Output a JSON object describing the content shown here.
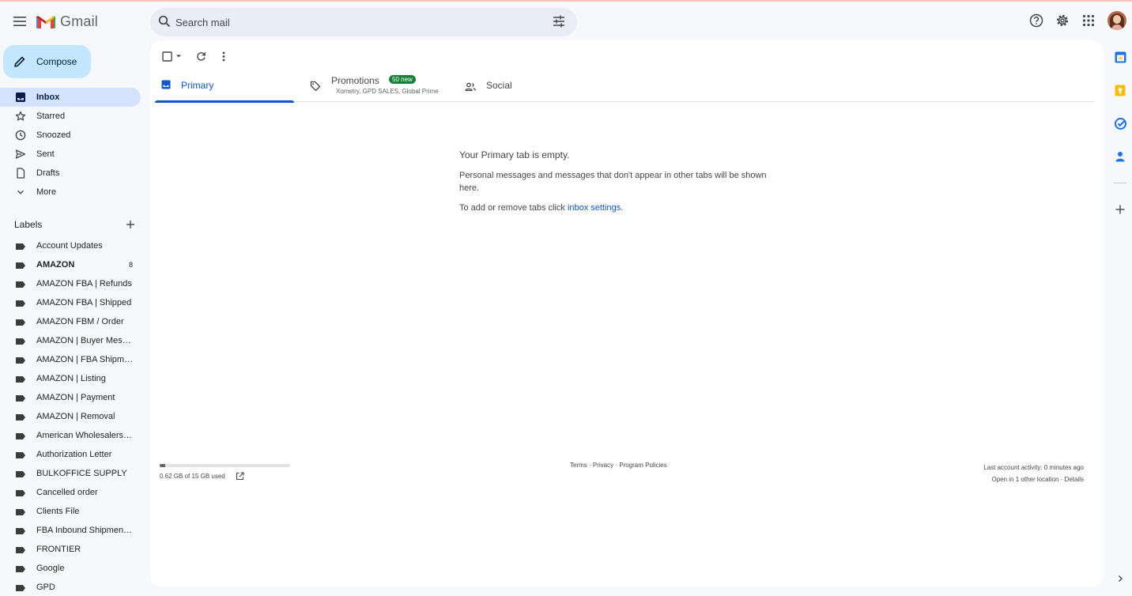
{
  "app": {
    "name": "Gmail"
  },
  "search": {
    "placeholder": "Search mail"
  },
  "compose": {
    "label": "Compose"
  },
  "nav": [
    {
      "label": "Inbox",
      "icon": "inbox-icon",
      "active": true
    },
    {
      "label": "Starred",
      "icon": "star-icon"
    },
    {
      "label": "Snoozed",
      "icon": "clock-icon"
    },
    {
      "label": "Sent",
      "icon": "send-icon"
    },
    {
      "label": "Drafts",
      "icon": "draft-icon"
    },
    {
      "label": "More",
      "icon": "chevron-down-icon"
    }
  ],
  "labels_heading": "Labels",
  "labels": [
    {
      "name": "Account Updates"
    },
    {
      "name": "AMAZON",
      "count": "8",
      "bold": true
    },
    {
      "name": "AMAZON FBA | Refunds"
    },
    {
      "name": "AMAZON FBA | Shipped"
    },
    {
      "name": "AMAZON FBM / Order"
    },
    {
      "name": "AMAZON | Buyer Messages"
    },
    {
      "name": "AMAZON | FBA Shipment"
    },
    {
      "name": "AMAZON | Listing"
    },
    {
      "name": "AMAZON | Payment"
    },
    {
      "name": "AMAZON | Removal"
    },
    {
      "name": "American Wholesalers Inc"
    },
    {
      "name": "Authorization Letter"
    },
    {
      "name": "BULKOFFICE SUPPLY"
    },
    {
      "name": "Cancelled order"
    },
    {
      "name": "Clients File"
    },
    {
      "name": "FBA Inbound Shipment Issues"
    },
    {
      "name": "FRONTIER"
    },
    {
      "name": "Google"
    },
    {
      "name": "GPD"
    }
  ],
  "tabs": {
    "primary": {
      "label": "Primary"
    },
    "promotions": {
      "label": "Promotions",
      "badge": "50 new",
      "subtitle": "Xometry, GPD SALES, Global Prime"
    },
    "social": {
      "label": "Social"
    }
  },
  "empty": {
    "title": "Your Primary tab is empty.",
    "body": "Personal messages and messages that don't appear in other tabs will be shown here.",
    "tip_prefix": "To add or remove tabs click ",
    "tip_link": "inbox settings",
    "tip_suffix": "."
  },
  "storage": {
    "text": "0.62 GB of 15 GB used",
    "used_fraction": 0.041
  },
  "footer": {
    "terms": "Terms",
    "privacy": "Privacy",
    "policies": "Program Policies",
    "sep": " · "
  },
  "activity": {
    "line1": "Last account activity: 0 minutes ago",
    "line2_prefix": "Open in 1 other location · ",
    "details": "Details"
  },
  "colors": {
    "accent": "#0b57d0",
    "compose_bg": "#c2e7ff",
    "active_nav": "#d3e3fd",
    "badge": "#188038"
  }
}
